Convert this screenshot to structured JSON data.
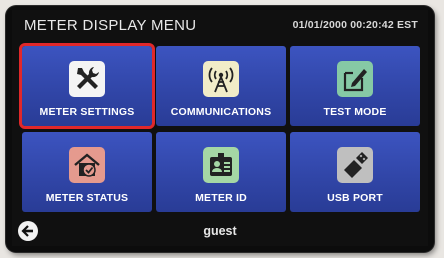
{
  "header": {
    "title": "METER DISPLAY MENU",
    "datetime": "01/01/2000 00:20:42 EST"
  },
  "tiles": [
    {
      "label": "METER SETTINGS",
      "icon": "tools-icon",
      "selected": true
    },
    {
      "label": "COMMUNICATIONS",
      "icon": "antenna-icon",
      "selected": false
    },
    {
      "label": "TEST MODE",
      "icon": "test-document-icon",
      "selected": false
    },
    {
      "label": "METER STATUS",
      "icon": "home-check-icon",
      "selected": false
    },
    {
      "label": "METER ID",
      "icon": "id-badge-icon",
      "selected": false
    },
    {
      "label": "USB PORT",
      "icon": "usb-icon",
      "selected": false
    }
  ],
  "footer": {
    "user": "guest",
    "back_icon": "back-arrow-icon"
  },
  "colors": {
    "tile": "#3146a8",
    "selected_border": "#e1282a",
    "screen": "#101010"
  }
}
